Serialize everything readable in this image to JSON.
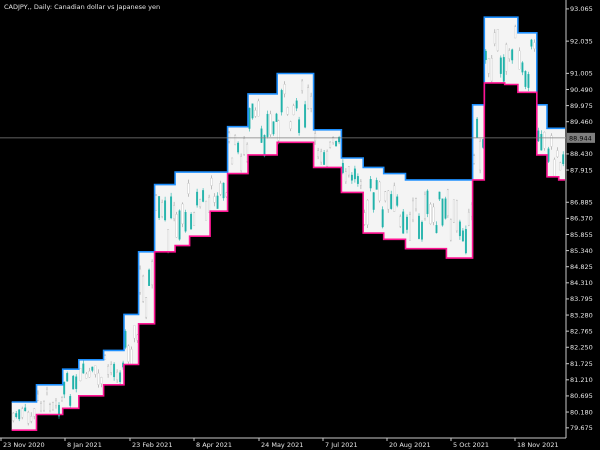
{
  "window": {
    "title": "CADJPY,, Daily:  Canadian dollar vs Japanese yen"
  },
  "colors": {
    "background": "#000000",
    "fill": "#f4f4f4",
    "upper_line": "#1e90ff",
    "lower_line": "#ff1493",
    "candle_up": "#20b2aa",
    "candle_down": "#ffffff",
    "axis": "#c8c8c8",
    "current_price_line": "#7f7f7f",
    "current_price_box": "#7f7f7f"
  },
  "chart_data": {
    "type": "candlestick-channel",
    "symbol": "CADJPY",
    "timeframe": "Daily",
    "y_axis": {
      "ticks": [
        "93.065",
        "92.035",
        "91.005",
        "90.490",
        "89.975",
        "89.460",
        "88.430",
        "87.915",
        "86.885",
        "86.370",
        "85.855",
        "85.340",
        "84.825",
        "84.310",
        "83.795",
        "83.280",
        "82.765",
        "82.250",
        "81.725",
        "81.210",
        "80.695",
        "80.180",
        "79.675"
      ],
      "ylim": [
        79.35,
        93.35
      ]
    },
    "x_axis": {
      "labels": [
        "23 Nov 2020",
        "8 Jan 2021",
        "23 Feb 2021",
        "8 Apr 2021",
        "24 May 2021",
        "7 Jul 2021",
        "20 Aug 2021",
        "5 Oct 2021",
        "18 Nov 2021"
      ]
    },
    "current_price": "88.944",
    "channel": [
      {
        "date": "2020-11-23",
        "upper": 80.5,
        "lower": 79.6
      },
      {
        "date": "2020-12-10",
        "upper": 81.05,
        "lower": 80.1
      },
      {
        "date": "2020-12-28",
        "upper": 81.55,
        "lower": 80.3
      },
      {
        "date": "2021-01-08",
        "upper": 81.85,
        "lower": 80.7
      },
      {
        "date": "2021-01-25",
        "upper": 82.15,
        "lower": 81.05
      },
      {
        "date": "2021-02-08",
        "upper": 83.3,
        "lower": 81.7
      },
      {
        "date": "2021-02-18",
        "upper": 85.3,
        "lower": 83.0
      },
      {
        "date": "2021-03-01",
        "upper": 87.45,
        "lower": 85.3
      },
      {
        "date": "2021-03-15",
        "upper": 87.85,
        "lower": 85.5
      },
      {
        "date": "2021-03-25",
        "upper": 87.85,
        "lower": 85.8
      },
      {
        "date": "2021-04-08",
        "upper": 87.85,
        "lower": 86.6
      },
      {
        "date": "2021-04-20",
        "upper": 89.3,
        "lower": 87.8
      },
      {
        "date": "2021-05-04",
        "upper": 90.35,
        "lower": 88.4
      },
      {
        "date": "2021-05-24",
        "upper": 91.0,
        "lower": 88.8
      },
      {
        "date": "2021-06-07",
        "upper": 91.0,
        "lower": 88.8
      },
      {
        "date": "2021-06-18",
        "upper": 89.2,
        "lower": 88.0
      },
      {
        "date": "2021-07-07",
        "upper": 88.3,
        "lower": 87.2
      },
      {
        "date": "2021-07-22",
        "upper": 88.0,
        "lower": 85.9
      },
      {
        "date": "2021-08-05",
        "upper": 87.8,
        "lower": 85.7
      },
      {
        "date": "2021-08-20",
        "upper": 87.6,
        "lower": 85.4
      },
      {
        "date": "2021-09-03",
        "upper": 87.6,
        "lower": 85.4
      },
      {
        "date": "2021-09-17",
        "upper": 87.6,
        "lower": 85.1
      },
      {
        "date": "2021-10-05",
        "upper": 90.0,
        "lower": 87.6
      },
      {
        "date": "2021-10-13",
        "upper": 92.8,
        "lower": 90.7
      },
      {
        "date": "2021-10-27",
        "upper": 92.8,
        "lower": 90.65
      },
      {
        "date": "2021-11-05",
        "upper": 92.3,
        "lower": 90.4
      },
      {
        "date": "2021-11-18",
        "upper": 90.0,
        "lower": 88.4
      },
      {
        "date": "2021-11-25",
        "upper": 89.25,
        "lower": 87.7
      },
      {
        "date": "2021-12-03",
        "upper": 89.25,
        "lower": 87.6
      }
    ]
  }
}
